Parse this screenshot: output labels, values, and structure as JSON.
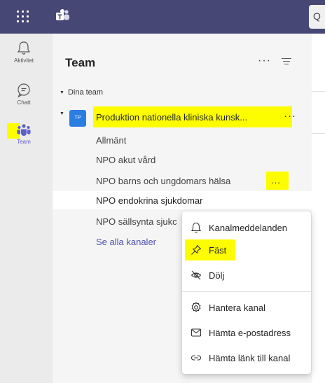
{
  "rail": {
    "items": [
      {
        "label": "Aktivitet",
        "icon": "bell-icon"
      },
      {
        "label": "Chatt",
        "icon": "chat-icon"
      },
      {
        "label": "Team",
        "icon": "teams-people-icon"
      }
    ]
  },
  "panel": {
    "title": "Team",
    "more_label": "···",
    "section_label": "Dina team",
    "team": {
      "avatar": "TP",
      "name": "Produktion nationella kliniska kunsk...",
      "more_label": "···"
    },
    "channels": [
      {
        "label": "Allmänt"
      },
      {
        "label": "NPO akut vård"
      },
      {
        "label": "NPO barns och ungdomars hälsa",
        "more_label": "..."
      },
      {
        "label": "NPO endokrina sjukdomar"
      },
      {
        "label": "NPO sällsynta sjukc"
      }
    ],
    "see_all": "Se alla kanaler"
  },
  "context_menu": {
    "items": [
      {
        "label": "Kanalmeddelanden",
        "icon": "bell-icon"
      },
      {
        "label": "Fäst",
        "icon": "pin-icon"
      },
      {
        "label": "Dölj",
        "icon": "eye-off-icon"
      },
      {
        "label": "Hantera kanal",
        "icon": "gear-icon"
      },
      {
        "label": "Hämta e-postadress",
        "icon": "mail-icon"
      },
      {
        "label": "Hämta länk till kanal",
        "icon": "link-icon"
      }
    ]
  },
  "colors": {
    "topbar": "#464775",
    "accent": "#5b5fc7",
    "highlight": "#fdfd00",
    "avatar": "#2a7de1"
  }
}
